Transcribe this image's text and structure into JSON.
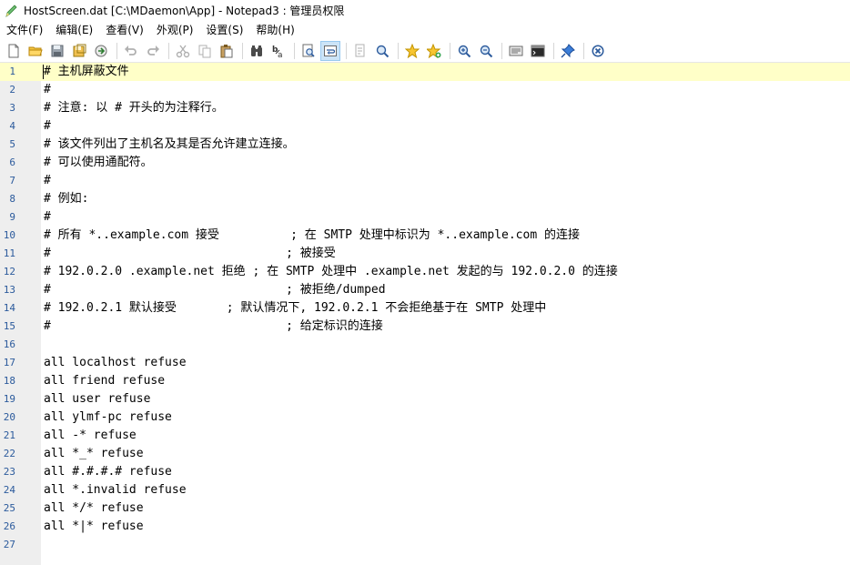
{
  "window": {
    "title": "HostScreen.dat [C:\\MDaemon\\App] - Notepad3 : 管理员权限"
  },
  "menu": {
    "items": [
      {
        "label": "文件(F)"
      },
      {
        "label": "编辑(E)"
      },
      {
        "label": "查看(V)"
      },
      {
        "label": "外观(P)"
      },
      {
        "label": "设置(S)"
      },
      {
        "label": "帮助(H)"
      }
    ]
  },
  "toolbar": {
    "buttons": [
      {
        "icon": "new-file-icon"
      },
      {
        "icon": "open-folder-icon"
      },
      {
        "icon": "save-icon"
      },
      {
        "icon": "save-as-icon"
      },
      {
        "icon": "browse-icon"
      },
      {
        "icon": "undo-icon"
      },
      {
        "icon": "redo-icon"
      },
      {
        "icon": "cut-icon"
      },
      {
        "icon": "copy-icon"
      },
      {
        "icon": "paste-icon"
      },
      {
        "icon": "find-icon"
      },
      {
        "icon": "replace-icon"
      },
      {
        "icon": "find-in-files-icon"
      },
      {
        "icon": "word-wrap-icon"
      },
      {
        "icon": "goto-icon"
      },
      {
        "icon": "zoom-doc-icon"
      },
      {
        "icon": "favorite-icon"
      },
      {
        "icon": "add-favorite-icon"
      },
      {
        "icon": "zoom-in-icon"
      },
      {
        "icon": "zoom-out-icon"
      },
      {
        "icon": "settings-screen-icon"
      },
      {
        "icon": "terminal-icon"
      },
      {
        "icon": "pin-icon"
      },
      {
        "icon": "close-icon"
      }
    ]
  },
  "editor": {
    "lines": [
      {
        "n": "1",
        "text": "# 主机屏蔽文件"
      },
      {
        "n": "2",
        "text": "#"
      },
      {
        "n": "3",
        "text": "# 注意: 以 # 开头的为注释行。"
      },
      {
        "n": "4",
        "text": "#"
      },
      {
        "n": "5",
        "text": "# 该文件列出了主机名及其是否允许建立连接。"
      },
      {
        "n": "6",
        "text": "# 可以使用通配符。"
      },
      {
        "n": "7",
        "text": "#"
      },
      {
        "n": "8",
        "text": "# 例如:"
      },
      {
        "n": "9",
        "text": "#"
      },
      {
        "n": "10",
        "text": "# 所有 *..example.com 接受          ; 在 SMTP 处理中标识为 *..example.com 的连接"
      },
      {
        "n": "11",
        "text": "#                                 ; 被接受"
      },
      {
        "n": "12",
        "text": "# 192.0.2.0 .example.net 拒绝 ; 在 SMTP 处理中 .example.net 发起的与 192.0.2.0 的连接"
      },
      {
        "n": "13",
        "text": "#                                 ; 被拒绝/dumped"
      },
      {
        "n": "14",
        "text": "# 192.0.2.1 默认接受       ; 默认情况下, 192.0.2.1 不会拒绝基于在 SMTP 处理中"
      },
      {
        "n": "15",
        "text": "#                                 ; 给定标识的连接"
      },
      {
        "n": "16",
        "text": ""
      },
      {
        "n": "17",
        "text": "all localhost refuse"
      },
      {
        "n": "18",
        "text": "all friend refuse"
      },
      {
        "n": "19",
        "text": "all user refuse"
      },
      {
        "n": "20",
        "text": "all ylmf-pc refuse"
      },
      {
        "n": "21",
        "text": "all -* refuse"
      },
      {
        "n": "22",
        "text": "all *_* refuse"
      },
      {
        "n": "23",
        "text": "all #.#.#.# refuse"
      },
      {
        "n": "24",
        "text": "all *.invalid refuse"
      },
      {
        "n": "25",
        "text": "all */* refuse"
      },
      {
        "n": "26",
        "text": "all *|* refuse"
      },
      {
        "n": "27",
        "text": ""
      }
    ]
  }
}
